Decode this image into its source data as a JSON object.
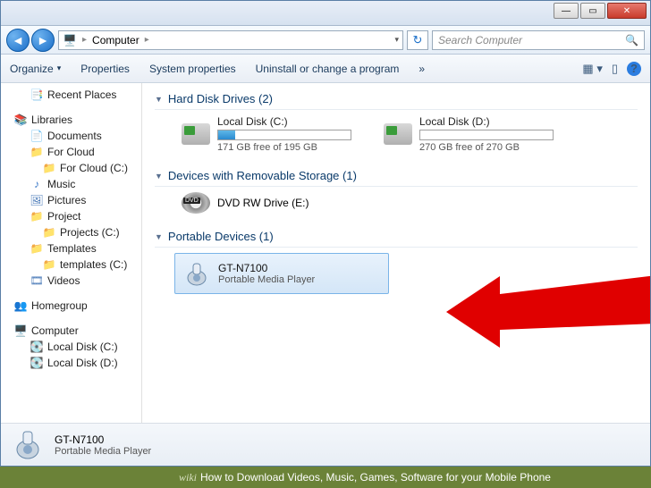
{
  "address": {
    "location": "Computer"
  },
  "search": {
    "placeholder": "Search Computer"
  },
  "toolbar": {
    "organize": "Organize",
    "properties": "Properties",
    "system_properties": "System properties",
    "uninstall": "Uninstall or change a program",
    "chevrons": "»"
  },
  "sidebar": {
    "recent": "Recent Places",
    "libraries": "Libraries",
    "documents": "Documents",
    "for_cloud": "For Cloud",
    "for_cloud_c": "For Cloud (C:)",
    "music": "Music",
    "pictures": "Pictures",
    "project": "Project",
    "projects_c": "Projects (C:)",
    "templates": "Templates",
    "templates_c": "templates (C:)",
    "videos": "Videos",
    "homegroup": "Homegroup",
    "computer": "Computer",
    "local_c": "Local Disk (C:)",
    "local_d": "Local Disk (D:)"
  },
  "sections": {
    "hdd": "Hard Disk Drives (2)",
    "removable": "Devices with Removable Storage (1)",
    "portable": "Portable Devices (1)"
  },
  "drives": {
    "c": {
      "name": "Local Disk (C:)",
      "free": "171 GB free of 195 GB",
      "fill_pct": 13
    },
    "d": {
      "name": "Local Disk (D:)",
      "free": "270 GB free of 270 GB",
      "fill_pct": 0
    }
  },
  "dvd": {
    "name": "DVD RW Drive (E:)"
  },
  "portable": {
    "name": "GT-N7100",
    "type": "Portable Media Player"
  },
  "details": {
    "name": "GT-N7100",
    "type": "Portable Media Player"
  },
  "banner": {
    "brand": "wiki",
    "title": "How to Download Videos, Music, Games, Software for your Mobile Phone"
  }
}
